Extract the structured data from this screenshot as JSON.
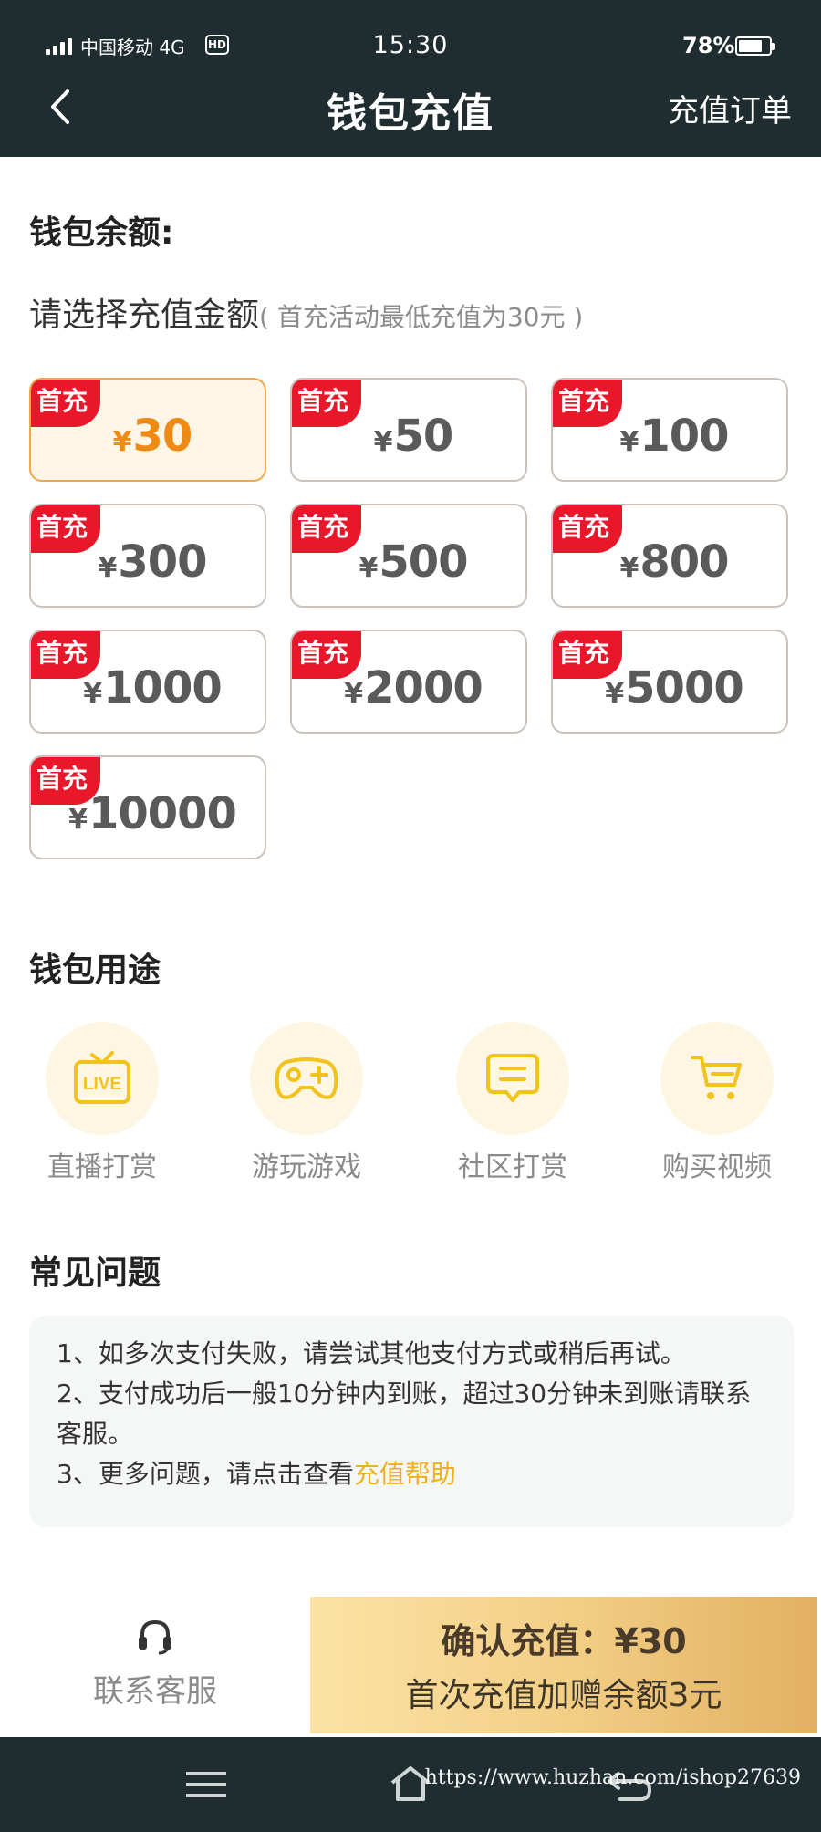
{
  "status_bar": {
    "carrier": "中国移动 4G",
    "hd": "HD",
    "time": "15:30",
    "battery_text": "78%",
    "battery_level": 0.78
  },
  "header": {
    "title": "钱包充值",
    "orders_link": "充值订单"
  },
  "balance": {
    "label": "钱包余额:"
  },
  "select": {
    "title": "请选择充值金额",
    "note": "( 首充活动最低充值为30元 )"
  },
  "amounts": {
    "currency": "¥",
    "promo_tag": "首充",
    "selected_index": 0,
    "items": [
      "30",
      "50",
      "100",
      "300",
      "500",
      "800",
      "1000",
      "2000",
      "5000",
      "10000"
    ]
  },
  "usage": {
    "title": "钱包用途",
    "items": [
      {
        "label": "直播打赏",
        "icon": "live-tv-icon"
      },
      {
        "label": "游玩游戏",
        "icon": "gamepad-icon"
      },
      {
        "label": "社区打赏",
        "icon": "chat-bubble-icon"
      },
      {
        "label": "购买视频",
        "icon": "shopping-cart-icon"
      }
    ],
    "accent_color": "#f3c21b",
    "circle_color": "#fdf6e3"
  },
  "faq": {
    "title": "常见问题",
    "line1": "1、如多次支付失败，请尝试其他支付方式或稍后再试。",
    "line2a": "2、支付成功后一般10分钟内到账，超过30分钟未到账请联系",
    "line2b": "客服。",
    "line3_prefix": "3、更多问题，请点击查看",
    "line3_link": "充值帮助"
  },
  "bottom": {
    "support_label": "联系客服",
    "confirm_main": "确认充值：¥30",
    "confirm_sub": "首次充值加赠余额3元"
  },
  "watermark": "https://www.huzhan.com/ishop27639",
  "colors": {
    "header_bg": "#1f2d30",
    "promo_red": "#e8172a",
    "selected_orange": "#ee8a16",
    "link_gold": "#efb020"
  }
}
